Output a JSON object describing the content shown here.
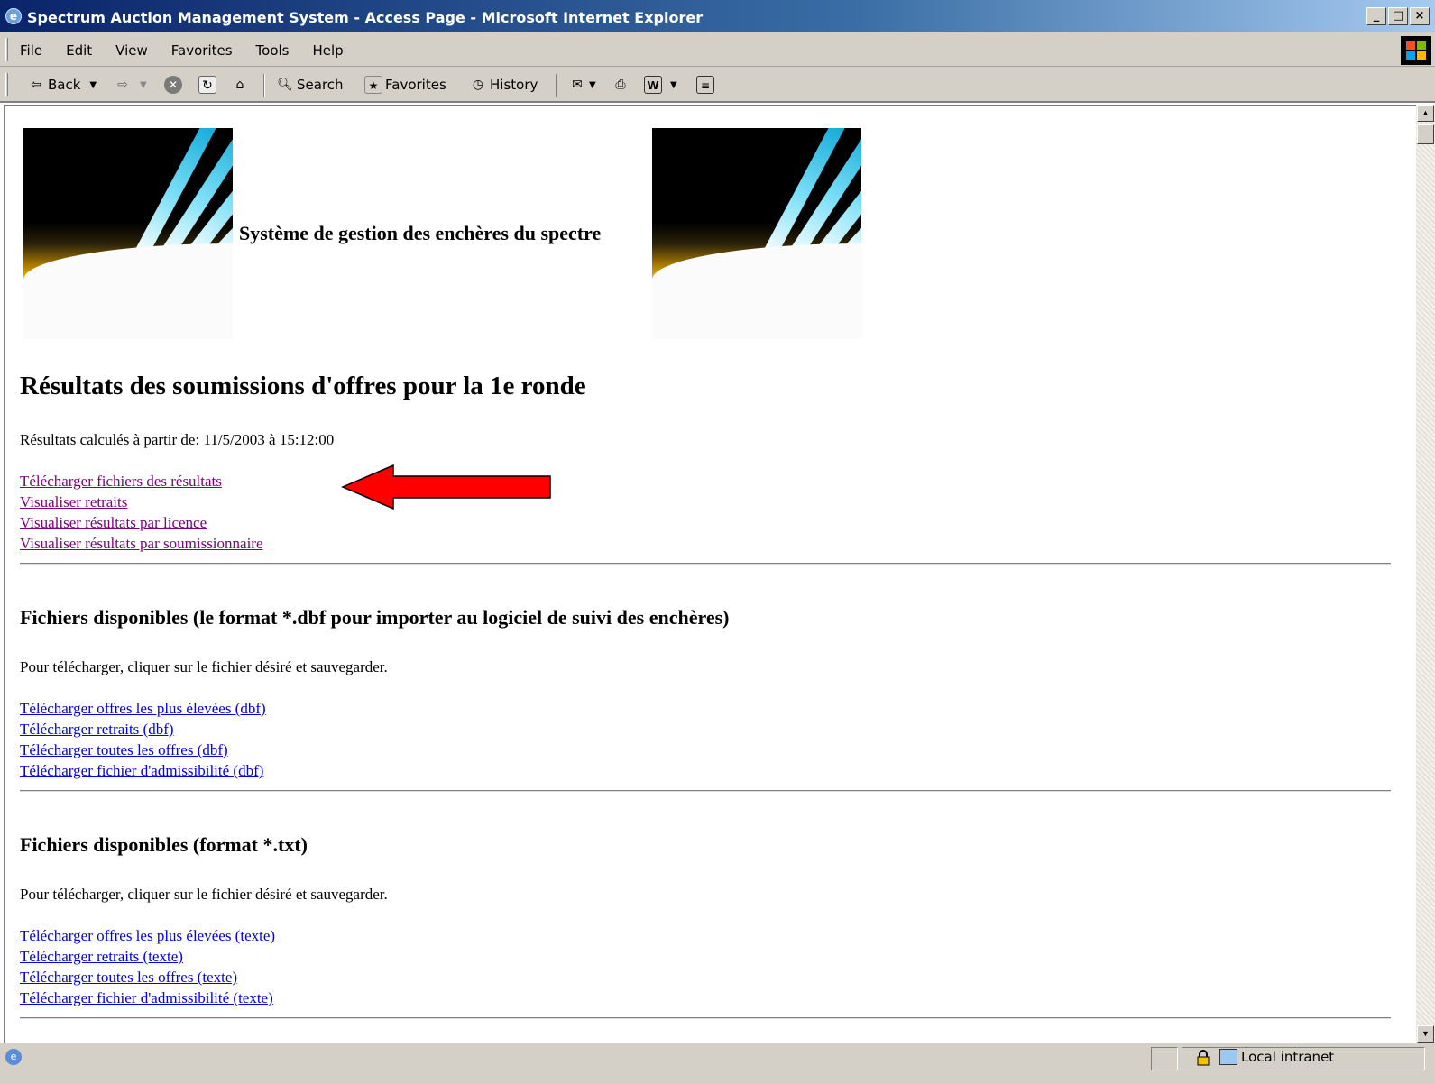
{
  "window": {
    "title": "Spectrum Auction Management System - Access Page - Microsoft Internet Explorer",
    "buttons": {
      "minimize": "_",
      "maximize": "□",
      "close": "×"
    }
  },
  "menu": {
    "items": [
      "File",
      "Edit",
      "View",
      "Favorites",
      "Tools",
      "Help"
    ]
  },
  "toolbar": {
    "back_label": "Back",
    "search_label": "Search",
    "favorites_label": "Favorites",
    "history_label": "History"
  },
  "page": {
    "banner_text": "Système de gestion des enchères du spectre",
    "title": "Résultats des soumissions d'offres pour la 1e ronde",
    "computed_at": "Résultats calculés à partir de: 11/5/2003 à 15:12:00",
    "nav_links": [
      "Télécharger fichiers des résultats",
      "Visualiser retraits",
      "Visualiser résultats par licence",
      "Visualiser résultats par soumissionnaire"
    ],
    "dbf_section": {
      "heading": "Fichiers disponibles (le format *.dbf pour importer au logiciel de suivi des enchères)",
      "instructions": "Pour télécharger, cliquer sur le fichier désiré et sauvegarder.",
      "links": [
        "Télécharger offres les plus élevées (dbf)",
        "Télécharger retraits (dbf)",
        "Télécharger toutes les offres (dbf)",
        "Télécharger fichier d'admissibilité (dbf)"
      ]
    },
    "txt_section": {
      "heading": "Fichiers disponibles (format *.txt)",
      "instructions": "Pour télécharger, cliquer sur le fichier désiré et sauvegarder.",
      "links": [
        "Télécharger offres les plus élevées (texte)",
        "Télécharger retraits (texte)",
        "Télécharger toutes les offres (texte)",
        "Télécharger fichier d'admissibilité (texte)"
      ]
    }
  },
  "status": {
    "zone_label": "Local intranet"
  },
  "colors": {
    "visited_link": "#800080",
    "link": "#0000ee",
    "annotation_arrow": "#ff0000",
    "titlebar": "#0a246a",
    "chrome": "#d4d0c8"
  }
}
